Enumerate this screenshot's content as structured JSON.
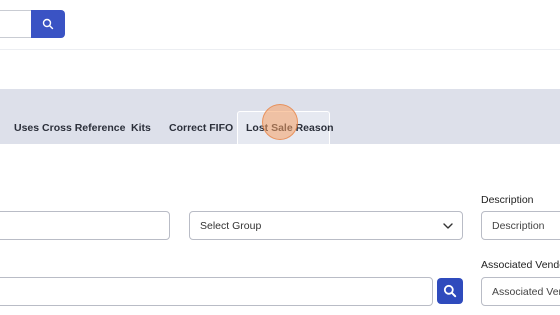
{
  "tabs": [
    {
      "label": "Uses Cross Reference"
    },
    {
      "label": "Kits"
    },
    {
      "label": "Correct FIFO"
    },
    {
      "label": "Lost Sale Reason",
      "active": true
    }
  ],
  "form": {
    "group_select": {
      "selected": "Select Group"
    },
    "description": {
      "label": "Description",
      "placeholder": "Description"
    },
    "associated_vendor": {
      "label": "Associated Vendo",
      "placeholder": "Associated Vendo"
    }
  },
  "icons": {
    "top_search": "search-icon",
    "field_search": "search-icon",
    "dropdown": "chevron-down-icon"
  },
  "colors": {
    "accent": "#3a53c4",
    "tab_bar": "#dde0ea",
    "cursor_highlight": "#f5a064"
  }
}
